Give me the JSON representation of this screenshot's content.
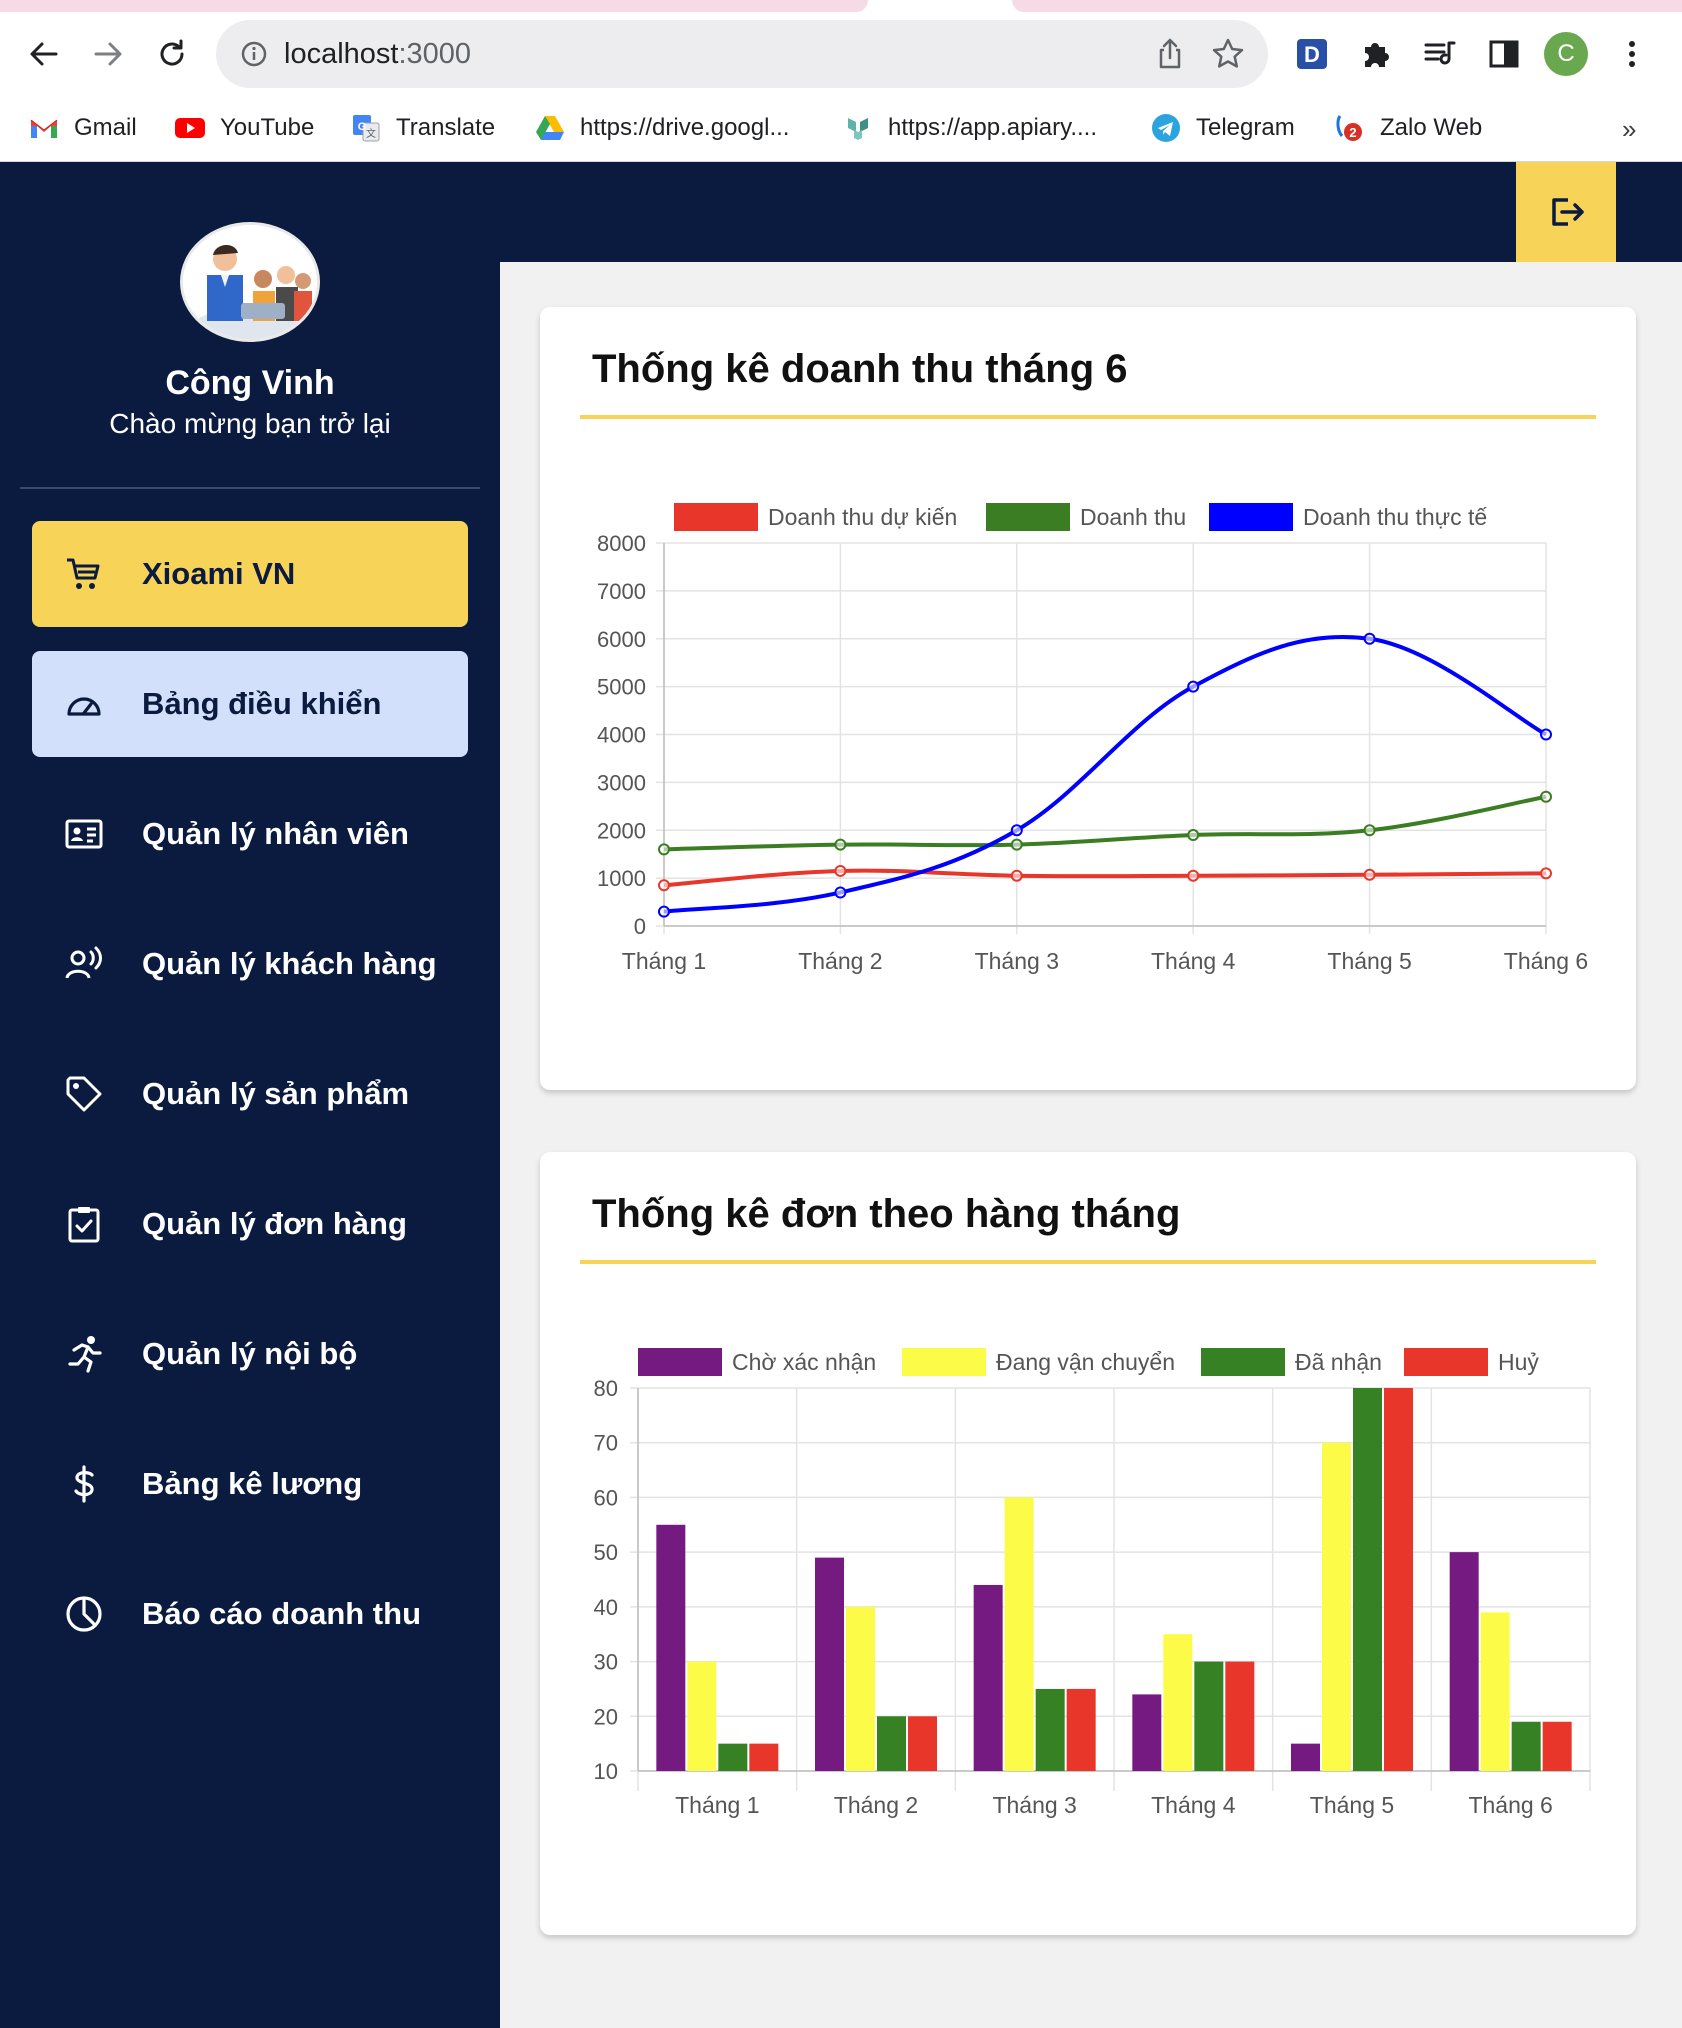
{
  "browser": {
    "url_host": "localhost",
    "url_port": ":3000",
    "profile_initial": "C",
    "bookmarks": [
      {
        "label": "Gmail",
        "icon": "gmail-icon"
      },
      {
        "label": "YouTube",
        "icon": "youtube-icon"
      },
      {
        "label": "Translate",
        "icon": "translate-icon"
      },
      {
        "label": "https://drive.googl...",
        "icon": "drive-icon"
      },
      {
        "label": "https://app.apiary....",
        "icon": "apiary-icon"
      },
      {
        "label": "Telegram",
        "icon": "telegram-icon"
      },
      {
        "label": "Zalo Web",
        "icon": "zalo-icon"
      }
    ],
    "more": "»"
  },
  "user": {
    "name": "Công Vinh",
    "welcome": "Chào mừng bạn trở lại"
  },
  "sidebar": {
    "items": [
      {
        "label": "Xioami VN",
        "icon": "cart-icon"
      },
      {
        "label": "Bảng điều khiển",
        "icon": "dashboard-icon"
      },
      {
        "label": "Quản lý nhân viên",
        "icon": "id-card-icon"
      },
      {
        "label": "Quản lý khách hàng",
        "icon": "customer-voice-icon"
      },
      {
        "label": "Quản lý sản phẩm",
        "icon": "tag-icon"
      },
      {
        "label": "Quản lý đơn hàng",
        "icon": "clipboard-check-icon"
      },
      {
        "label": "Quản lý nội bộ",
        "icon": "running-icon"
      },
      {
        "label": "Bảng kê lương",
        "icon": "dollar-icon"
      },
      {
        "label": "Báo cáo doanh thu",
        "icon": "pie-chart-icon"
      }
    ]
  },
  "cards": {
    "revenue_title": "Thống kê doanh thu tháng 6",
    "orders_title": "Thống kê đơn theo hàng tháng"
  },
  "chart_data": [
    {
      "type": "line",
      "title": "Thống kê doanh thu tháng 6",
      "categories": [
        "Tháng 1",
        "Tháng 2",
        "Tháng 3",
        "Tháng 4",
        "Tháng 5",
        "Tháng 6"
      ],
      "ylim": [
        0,
        8000
      ],
      "yticks": [
        0,
        1000,
        2000,
        3000,
        4000,
        5000,
        6000,
        7000,
        8000
      ],
      "grid": true,
      "legend_position": "top",
      "series": [
        {
          "name": "Doanh thu dự kiến",
          "color": "#e8372a",
          "values": [
            850,
            1150,
            1050,
            1050,
            1070,
            1100
          ]
        },
        {
          "name": "Doanh thu",
          "color": "#3a7d22",
          "values": [
            1600,
            1700,
            1700,
            1900,
            2000,
            2700
          ]
        },
        {
          "name": "Doanh thu thực tế",
          "color": "#0000ff",
          "values": [
            300,
            700,
            2000,
            5000,
            6000,
            4000
          ]
        }
      ]
    },
    {
      "type": "bar",
      "title": "Thống kê đơn theo hàng tháng",
      "categories": [
        "Tháng 1",
        "Tháng 2",
        "Tháng 3",
        "Tháng 4",
        "Tháng 5",
        "Tháng 6"
      ],
      "ylim": [
        10,
        80
      ],
      "yticks": [
        10,
        20,
        30,
        40,
        50,
        60,
        70,
        80
      ],
      "grid": true,
      "legend_position": "top",
      "series": [
        {
          "name": "Chờ xác nhận",
          "color": "#751a80",
          "values": [
            55,
            49,
            44,
            24,
            15,
            50
          ]
        },
        {
          "name": "Đang vận chuyển",
          "color": "#fcfc48",
          "values": [
            30,
            40,
            60,
            35,
            70,
            39
          ]
        },
        {
          "name": "Đã nhận",
          "color": "#358124",
          "values": [
            15,
            20,
            25,
            30,
            80,
            19
          ]
        },
        {
          "name": "Huỷ",
          "color": "#e8372a",
          "values": [
            15,
            20,
            25,
            30,
            80,
            19
          ]
        }
      ]
    }
  ]
}
